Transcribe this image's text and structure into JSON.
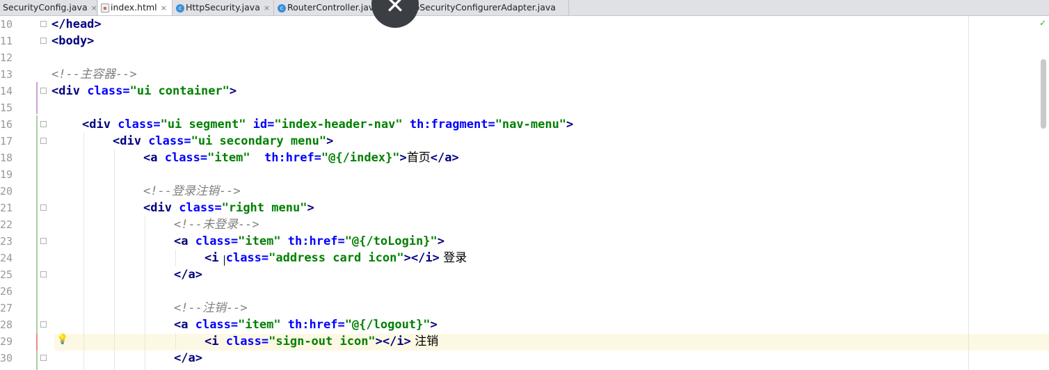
{
  "tabs": [
    {
      "label": "SecurityConfig.java",
      "icon": "java-class-icon",
      "active": false
    },
    {
      "label": "index.html",
      "icon": "html-file-icon",
      "active": true
    },
    {
      "label": "HttpSecurity.java",
      "icon": "java-class-icon",
      "active": false
    },
    {
      "label": "RouterController.java",
      "icon": "java-class-icon",
      "active": false
    },
    {
      "label": "WebSecurityConfigurerAdapter.java",
      "icon": "java-class-icon",
      "active": false
    }
  ],
  "tab_close_glyph": "×",
  "overlay_close_glyph": "✕",
  "line_numbers": [
    "10",
    "11",
    "12",
    "13",
    "14",
    "15",
    "16",
    "17",
    "18",
    "19",
    "20",
    "21",
    "22",
    "23",
    "24",
    "25",
    "26",
    "27",
    "28",
    "29",
    "30"
  ],
  "code": {
    "l10": {
      "t1": "</head>"
    },
    "l11": {
      "t1": "<body>"
    },
    "l13": {
      "c": "<!--主容器-->"
    },
    "l14": {
      "t1": "<div ",
      "a1": "class=",
      "v1": "\"ui container\"",
      "t2": ">"
    },
    "l16": {
      "t1": "<div ",
      "a1": "class=",
      "v1": "\"ui segment\"",
      "a2": " id=",
      "v2": "\"index-header-nav\"",
      "a3": " th:fragment=",
      "v3": "\"nav-menu\"",
      "t2": ">"
    },
    "l17": {
      "t1": "<div ",
      "a1": "class=",
      "v1": "\"ui secondary menu\"",
      "t2": ">"
    },
    "l18": {
      "t1": "<a ",
      "a1": "class=",
      "v1": "\"item\"",
      "a2": "  th:href=",
      "v2": "\"@{/index}\"",
      "t2": ">",
      "x": "首页",
      "t3": "</a>"
    },
    "l20": {
      "c": "<!--登录注销-->"
    },
    "l21": {
      "t1": "<div ",
      "a1": "class=",
      "v1": "\"right menu\"",
      "t2": ">"
    },
    "l22": {
      "c": "<!--未登录-->"
    },
    "l23": {
      "t1": "<a ",
      "a1": "class=",
      "v1": "\"item\"",
      "a2": " th:href=",
      "v2": "\"@{/toLogin}\"",
      "t2": ">"
    },
    "l24": {
      "t1": "<i ",
      "a1": "class=",
      "v1": "\"address card icon\"",
      "t2": "></i>",
      "x": " 登录"
    },
    "l25": {
      "t1": "</a>"
    },
    "l27": {
      "c": "<!--注销-->"
    },
    "l28": {
      "t1": "<a ",
      "a1": "class=",
      "v1": "\"item\"",
      "a2": " th:href=",
      "v2": "\"@{/logout}\"",
      "t2": ">"
    },
    "l29": {
      "t1": "<i ",
      "a1": "class=",
      "v1": "\"sign-out icon\"",
      "t2": "></i>",
      "x": " 注销"
    },
    "l30": {
      "t1": "</a>"
    }
  },
  "colors": {
    "tag": "#000080",
    "attr": "#0000ff",
    "value": "#008000",
    "comment": "#808080",
    "caret_line": "#fdf8e3"
  },
  "icons": {
    "intention": "lightbulb-icon",
    "inspection": "check-icon"
  }
}
